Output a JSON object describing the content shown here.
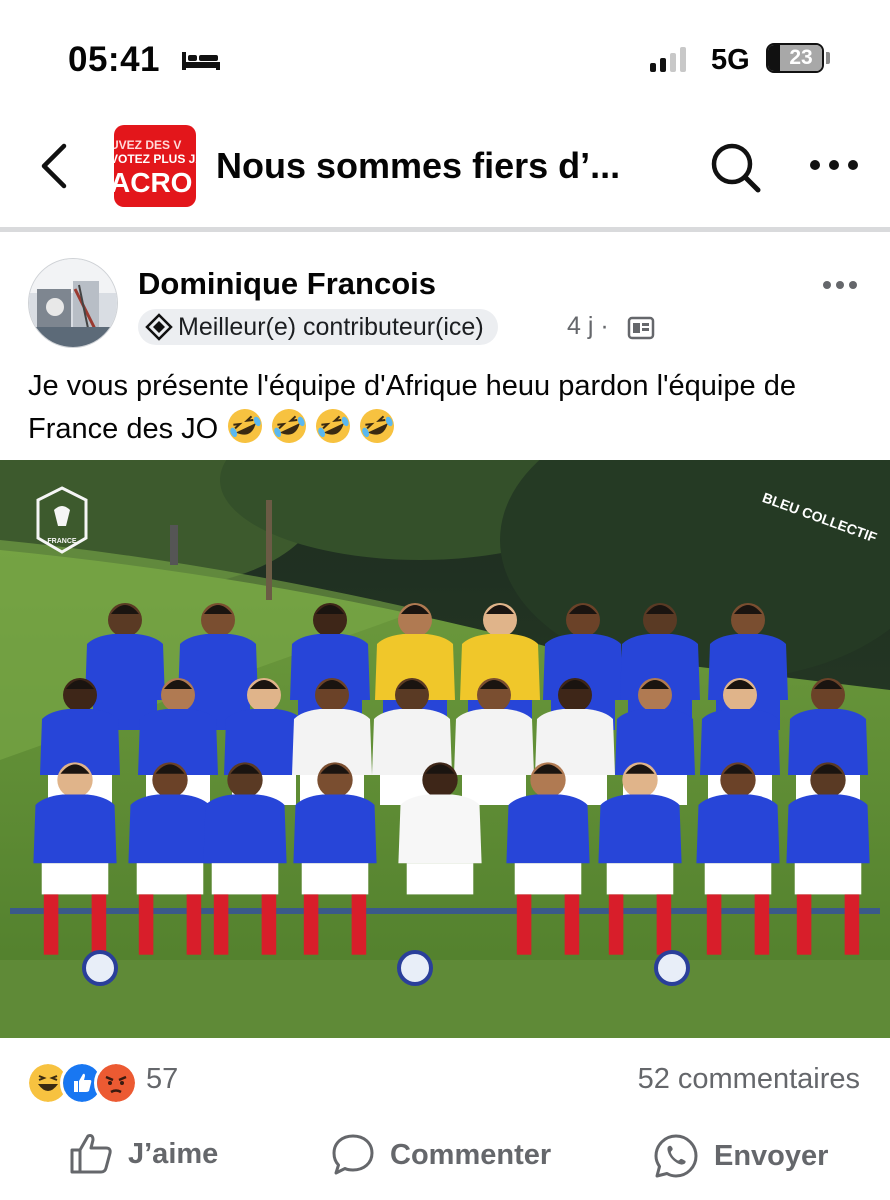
{
  "status_bar": {
    "time": "05:41",
    "network": "5G",
    "battery": "23"
  },
  "header": {
    "group_thumb_lines": [
      "UVEZ DES V",
      "VOTEZ PLUS JAM",
      "ACRO"
    ],
    "group_title": "Nous sommes fiers d’..."
  },
  "post": {
    "author": "Dominique Francois",
    "badge": "Meilleur(e) contributeur(ice)",
    "time": "4 j ·",
    "text": "Je vous présente l'équipe d'Afrique heuu pardon l'équipe de France des JO",
    "emojis": [
      "rolling-on-floor-laughing",
      "rolling-on-floor-laughing",
      "rolling-on-floor-laughing",
      "rolling-on-floor-laughing"
    ],
    "photo": {
      "logo_left_text": "FRANCE",
      "logo_right_text": "BLEU COLLECTIF"
    }
  },
  "stats": {
    "reactions": [
      "haha",
      "like",
      "angry"
    ],
    "reaction_count": "57",
    "comments": "52 commentaires"
  },
  "actions": {
    "like": "J’aime",
    "comment": "Commenter",
    "send": "Envoyer"
  },
  "colors": {
    "brand_red": "#e3161b",
    "muted_text": "#65676b",
    "jersey_blue": "#2745d8",
    "sock_red": "#d81e2a"
  }
}
